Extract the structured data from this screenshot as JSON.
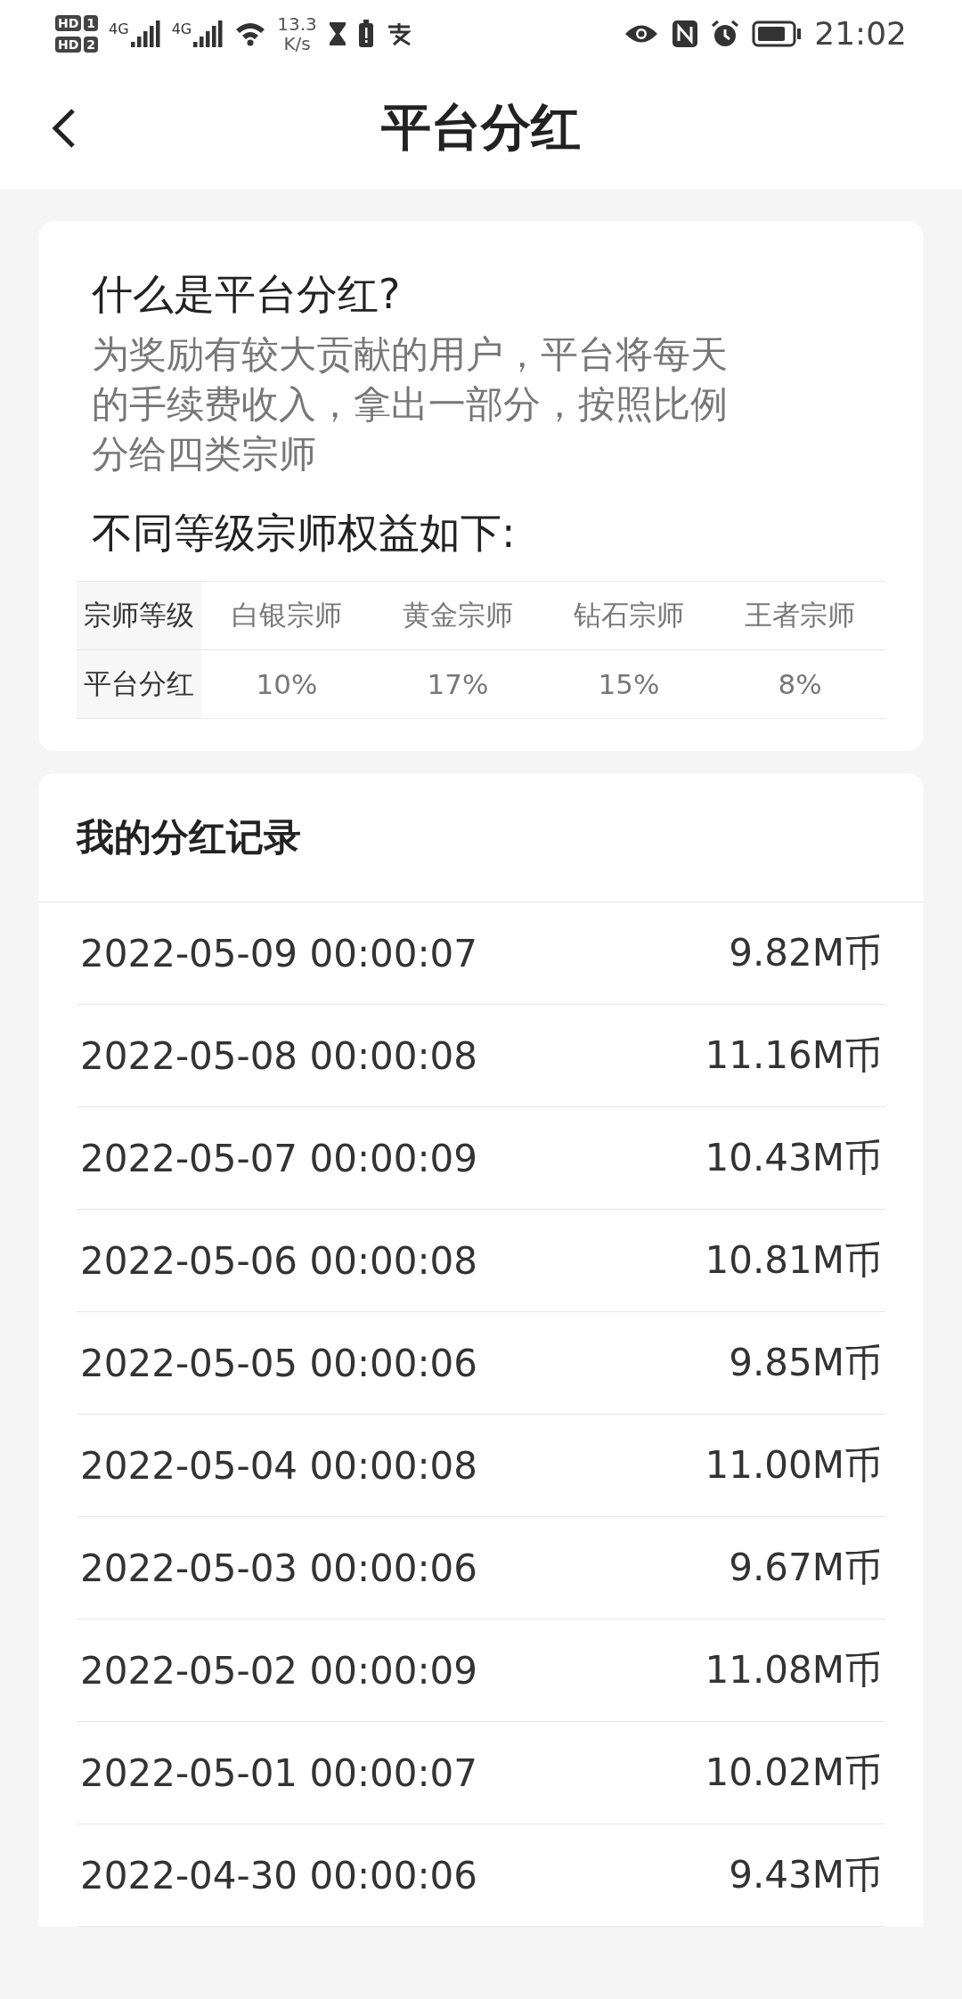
{
  "status_bar": {
    "sims": [
      {
        "badge": "HD",
        "slot": "1",
        "network": "4G"
      },
      {
        "badge": "HD",
        "slot": "2",
        "network": "4G"
      }
    ],
    "speed": "13.3",
    "speed_unit": "K/s",
    "time": "21:02"
  },
  "header": {
    "title": "平台分红"
  },
  "intro": {
    "question": "什么是平台分红?",
    "description": "为奖励有较大贡献的用户，平台将每天的手续费收入，拿出一部分，按照比例分给四类宗师",
    "table_title": "不同等级宗师权益如下:",
    "table": {
      "columns": [
        "宗师等级",
        "白银宗师",
        "黄金宗师",
        "钻石宗师",
        "王者宗师"
      ],
      "rows": [
        [
          "平台分红",
          "10%",
          "17%",
          "15%",
          "8%"
        ]
      ]
    }
  },
  "records": {
    "title": "我的分红记录",
    "items": [
      {
        "time": "2022-05-09 00:00:07",
        "amount": "9.82M币"
      },
      {
        "time": "2022-05-08 00:00:08",
        "amount": "11.16M币"
      },
      {
        "time": "2022-05-07 00:00:09",
        "amount": "10.43M币"
      },
      {
        "time": "2022-05-06 00:00:08",
        "amount": "10.81M币"
      },
      {
        "time": "2022-05-05 00:00:06",
        "amount": "9.85M币"
      },
      {
        "time": "2022-05-04 00:00:08",
        "amount": "11.00M币"
      },
      {
        "time": "2022-05-03 00:00:06",
        "amount": "9.67M币"
      },
      {
        "time": "2022-05-02 00:00:09",
        "amount": "11.08M币"
      },
      {
        "time": "2022-05-01 00:00:07",
        "amount": "10.02M币"
      },
      {
        "time": "2022-04-30 00:00:06",
        "amount": "9.43M币"
      }
    ]
  }
}
